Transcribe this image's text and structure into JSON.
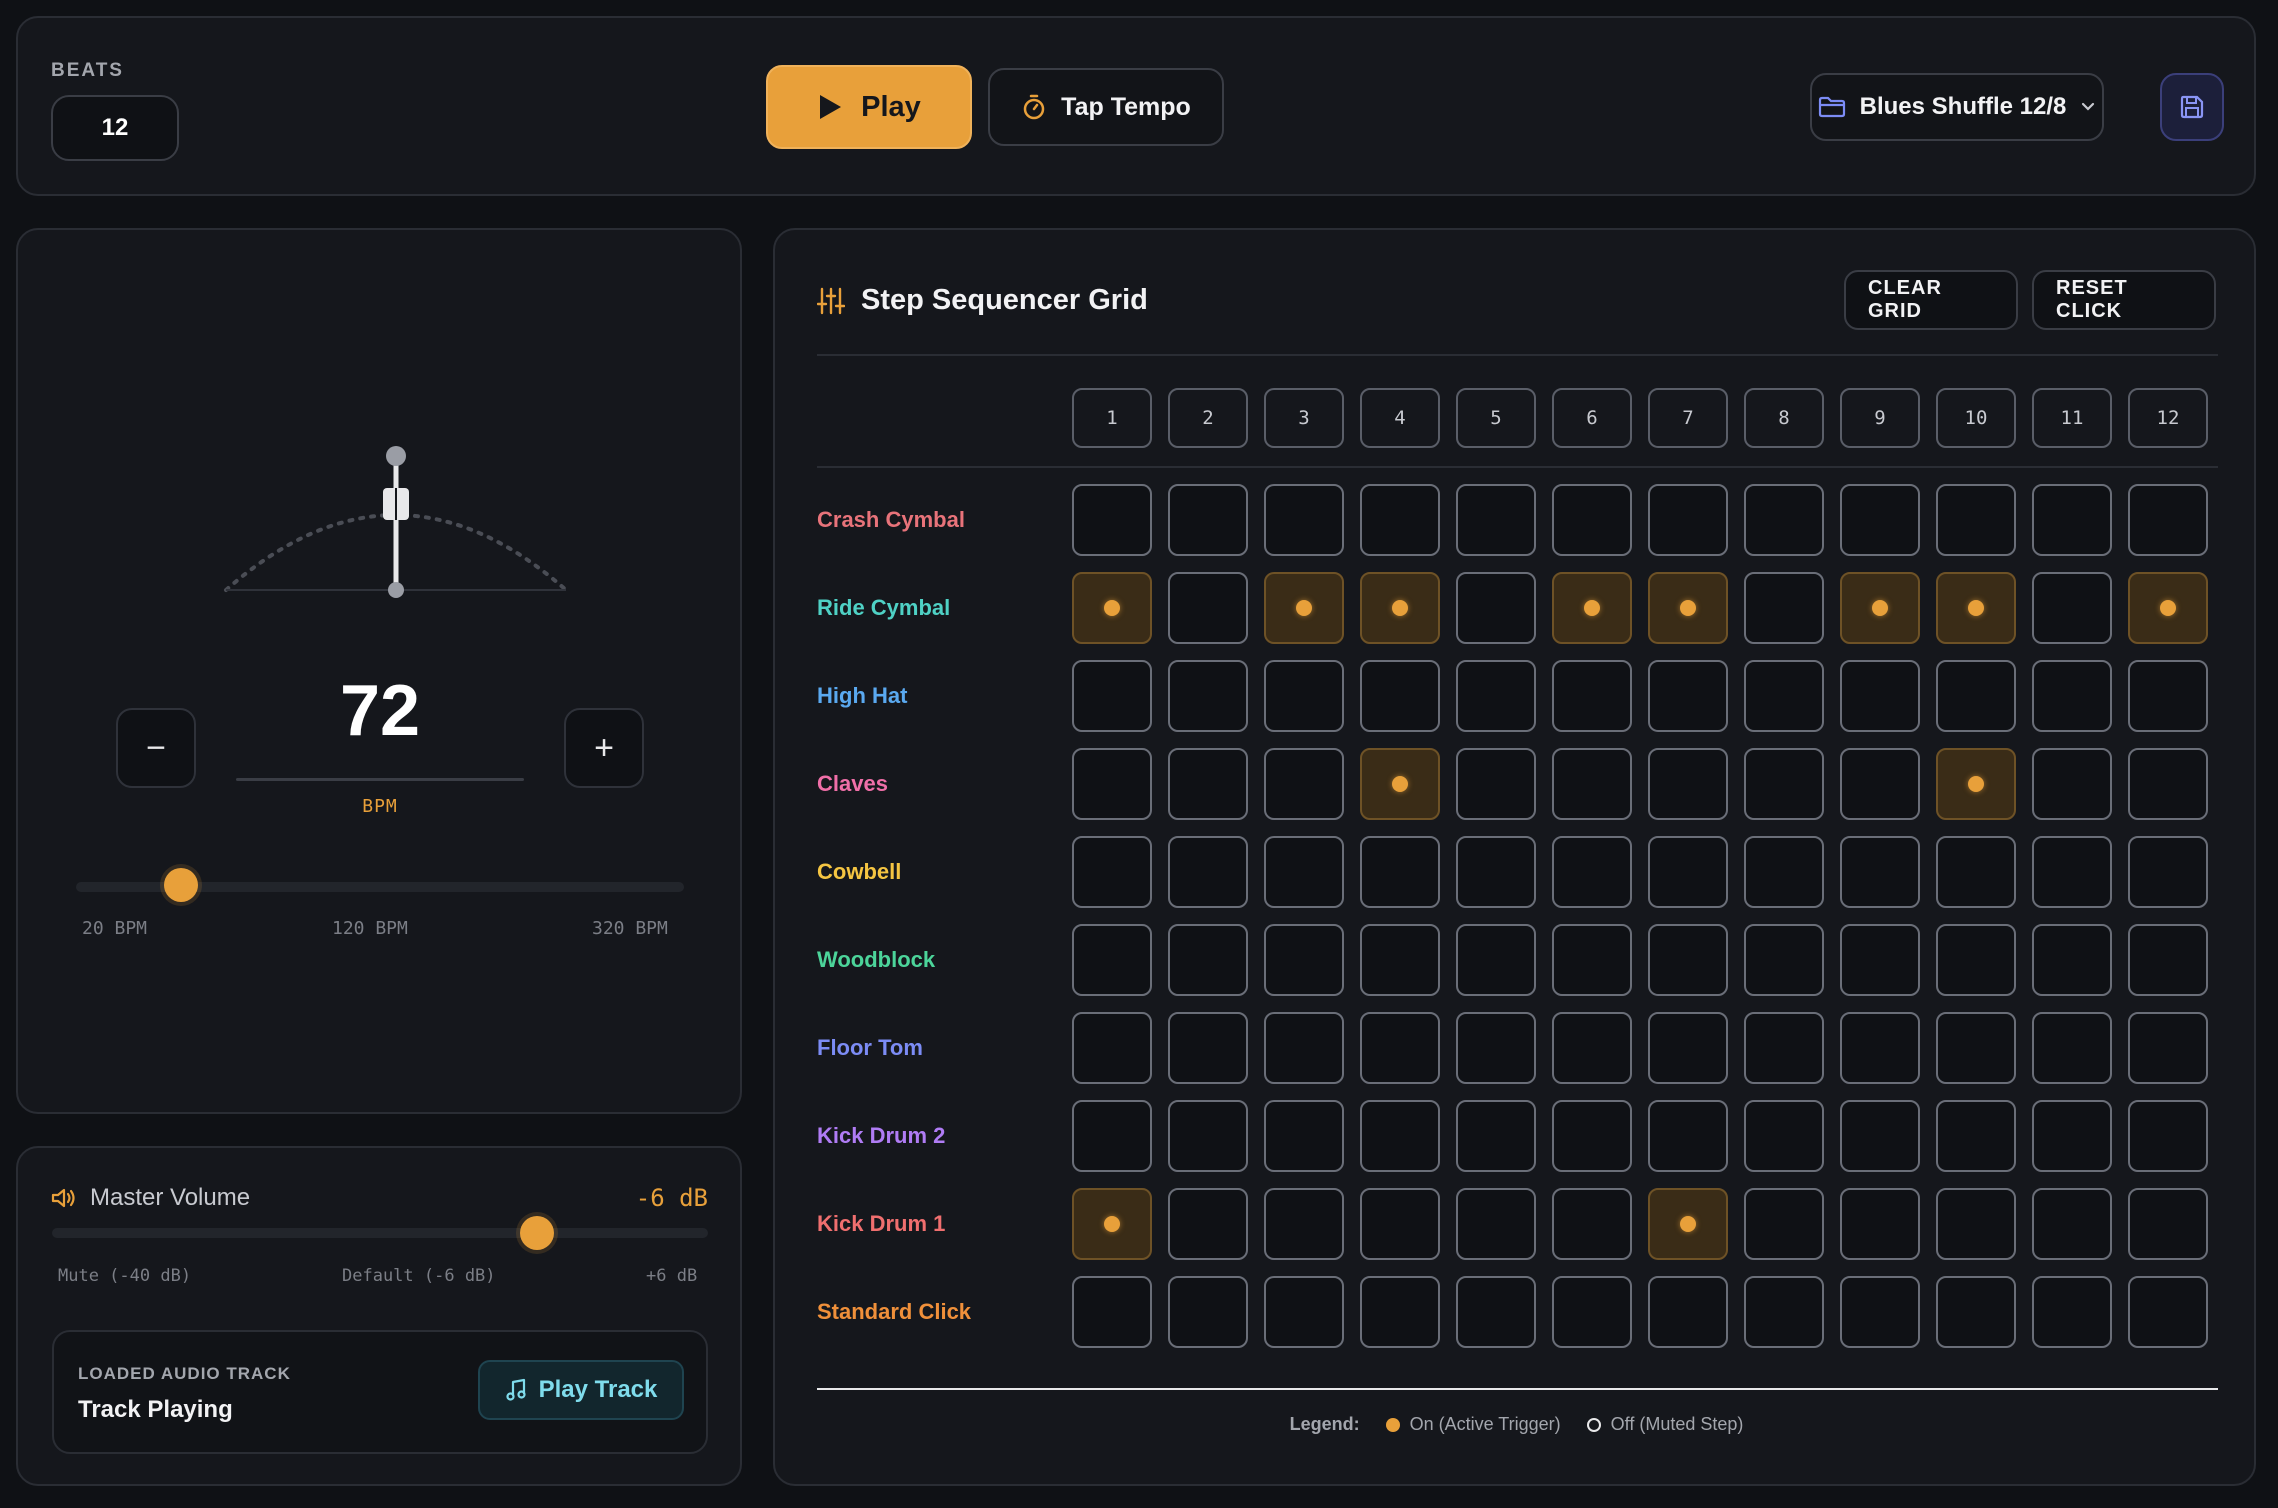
{
  "header": {
    "beats_label": "BEATS",
    "beats_value": "12",
    "play_label": "Play",
    "tap_tempo_label": "Tap Tempo",
    "preset_label": "Blues Shuffle 12/8"
  },
  "tempo": {
    "bpm": "72",
    "unit": "BPM",
    "minus": "−",
    "plus": "+",
    "min_label": "20 BPM",
    "mid_label": "120 BPM",
    "max_label": "320 BPM",
    "min_value": 20,
    "max_value": 320,
    "current_value": 72
  },
  "volume": {
    "title": "Master Volume",
    "db_label": "-6 dB",
    "min_label": "Mute (-40 dB)",
    "default_label": "Default (-6 dB)",
    "max_label": "+6 dB",
    "min_value": -40,
    "max_value": 6,
    "current_value": -6,
    "track_label": "LOADED AUDIO TRACK",
    "track_status": "Track Playing",
    "play_track_label": "Play Track"
  },
  "sequencer": {
    "title": "Step Sequencer Grid",
    "clear_label": "CLEAR GRID",
    "reset_label": "RESET CLICK",
    "columns": [
      "1",
      "2",
      "3",
      "4",
      "5",
      "6",
      "7",
      "8",
      "9",
      "10",
      "11",
      "12"
    ],
    "rows": [
      {
        "name": "Crash Cymbal",
        "color": "#e8737a",
        "steps": [
          0,
          0,
          0,
          0,
          0,
          0,
          0,
          0,
          0,
          0,
          0,
          0
        ]
      },
      {
        "name": "Ride Cymbal",
        "color": "#4fd1c5",
        "steps": [
          1,
          0,
          1,
          1,
          0,
          1,
          1,
          0,
          1,
          1,
          0,
          1
        ]
      },
      {
        "name": "High Hat",
        "color": "#5aa9f0",
        "steps": [
          0,
          0,
          0,
          0,
          0,
          0,
          0,
          0,
          0,
          0,
          0,
          0
        ]
      },
      {
        "name": "Claves",
        "color": "#f06fa8",
        "steps": [
          0,
          0,
          0,
          1,
          0,
          0,
          0,
          0,
          0,
          1,
          0,
          0
        ]
      },
      {
        "name": "Cowbell",
        "color": "#f5c542",
        "steps": [
          0,
          0,
          0,
          0,
          0,
          0,
          0,
          0,
          0,
          0,
          0,
          0
        ]
      },
      {
        "name": "Woodblock",
        "color": "#4cd49a",
        "steps": [
          0,
          0,
          0,
          0,
          0,
          0,
          0,
          0,
          0,
          0,
          0,
          0
        ]
      },
      {
        "name": "Floor Tom",
        "color": "#7c8cf5",
        "steps": [
          0,
          0,
          0,
          0,
          0,
          0,
          0,
          0,
          0,
          0,
          0,
          0
        ]
      },
      {
        "name": "Kick Drum 2",
        "color": "#b07cf5",
        "steps": [
          0,
          0,
          0,
          0,
          0,
          0,
          0,
          0,
          0,
          0,
          0,
          0
        ]
      },
      {
        "name": "Kick Drum 1",
        "color": "#f06f6f",
        "steps": [
          1,
          0,
          0,
          0,
          0,
          0,
          1,
          0,
          0,
          0,
          0,
          0
        ]
      },
      {
        "name": "Standard Click",
        "color": "#f0903a",
        "steps": [
          0,
          0,
          0,
          0,
          0,
          0,
          0,
          0,
          0,
          0,
          0,
          0
        ]
      }
    ],
    "legend_title": "Legend:",
    "legend_on": "On (Active Trigger)",
    "legend_off": "Off (Muted Step)"
  },
  "colors": {
    "accent": "#e8a03a",
    "background": "#0f1115",
    "panel": "#15171c"
  }
}
